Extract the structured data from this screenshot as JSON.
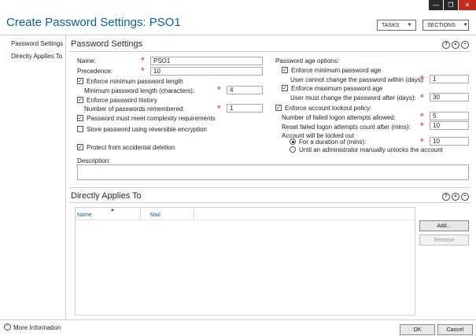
{
  "window": {
    "title": "Create Password Settings: PSO1",
    "tasks_label": "TASKS",
    "sections_label": "SECTIONS"
  },
  "nav": {
    "items": [
      "Password Settings",
      "Directly Applies To"
    ]
  },
  "password_settings": {
    "title": "Password Settings",
    "name_label": "Name:",
    "name_value": "PSO1",
    "precedence_label": "Precedence:",
    "precedence_value": "10",
    "enforce_min_length_label": "Enforce minimum password length",
    "min_length_label": "Minimum password length (characters):",
    "min_length_value": "4",
    "enforce_history_label": "Enforce password history",
    "history_label": "Number of passwords remembered:",
    "history_value": "1",
    "complexity_label": "Password must meet complexity requirements",
    "reversible_label": "Store password using reversible encryption",
    "protect_label": "Protect from accidental deletion",
    "description_label": "Description:",
    "age_options_label": "Password age options:",
    "enforce_min_age_label": "Enforce minimum password age",
    "min_age_label": "User cannot change the password within (days):",
    "min_age_value": "1",
    "enforce_max_age_label": "Enforce maximum password age",
    "max_age_label": "User must change the password after (days):",
    "max_age_value": "30",
    "lockout_policy_label": "Enforce account lockout policy:",
    "failed_attempts_label": "Number of failed logon attempts allowed:",
    "failed_attempts_value": "5",
    "reset_count_label": "Reset failed logon attempts count after (mins):",
    "reset_count_value": "10",
    "locked_out_label": "Account will be locked out",
    "duration_label": "For a duration of (mins):",
    "duration_value": "10",
    "until_admin_label": "Until an administrator manually unlocks the account"
  },
  "directly_applies_to": {
    "title": "Directly Applies To",
    "columns": [
      "Name",
      "Mail"
    ],
    "add_label": "Add...",
    "remove_label": "Remove"
  },
  "footer": {
    "more_info_label": "More Information",
    "ok_label": "OK",
    "cancel_label": "Cancel"
  },
  "icons": {
    "help": "?",
    "collapse": "⌃",
    "close": "×"
  },
  "colors": {
    "title_blue": "#0b5fa5",
    "required_star": "#e06a6a"
  }
}
